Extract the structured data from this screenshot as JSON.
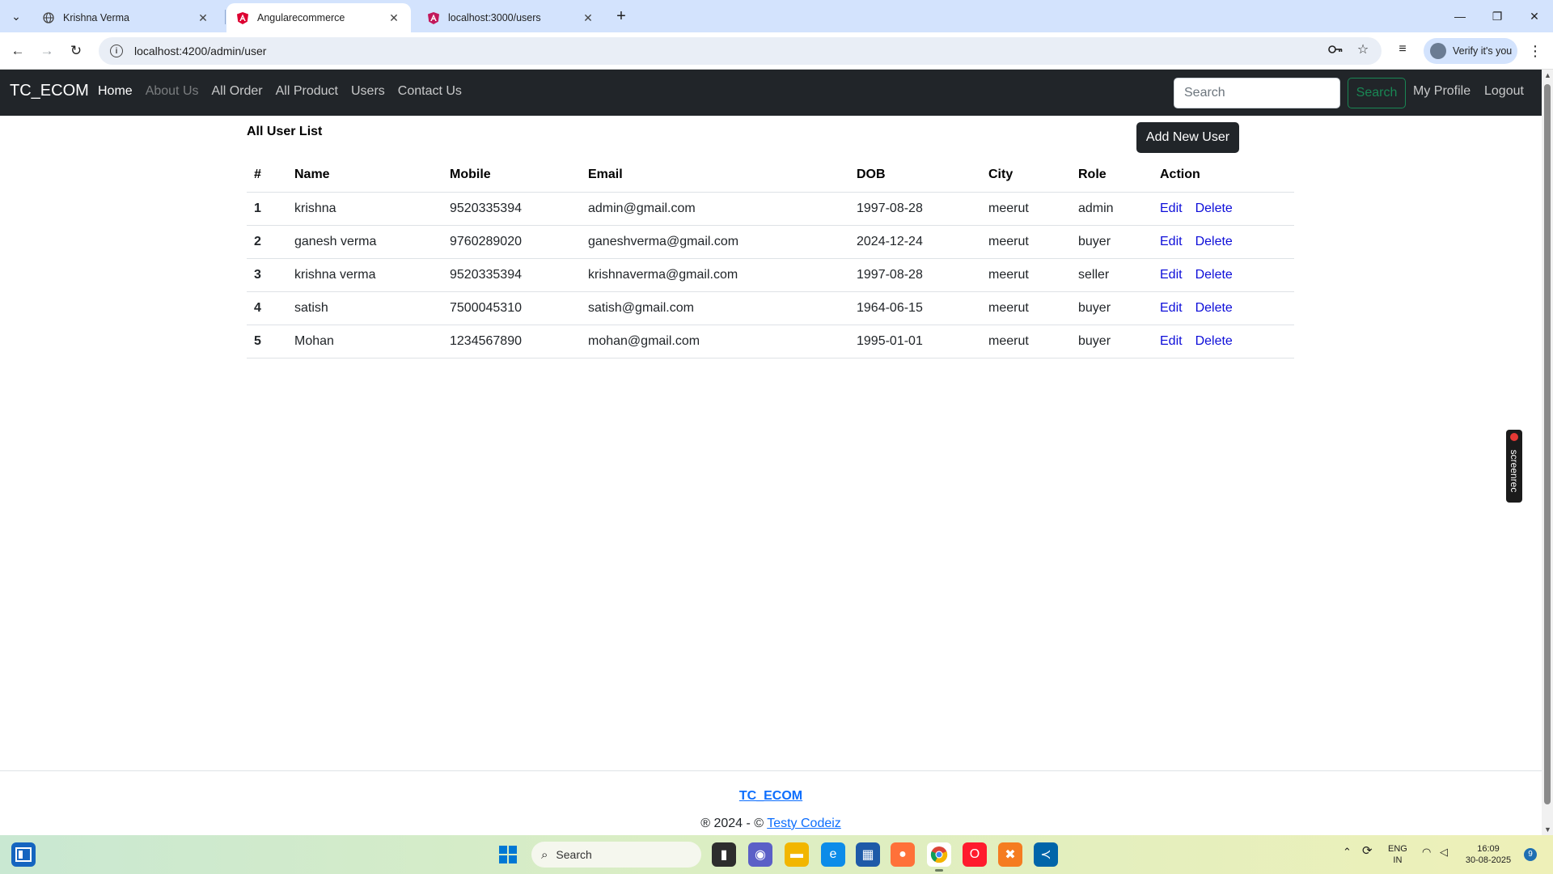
{
  "browser": {
    "tabs": [
      {
        "title": "Krishna Verma",
        "active": false
      },
      {
        "title": "Angularecommerce",
        "active": true
      },
      {
        "title": "localhost:3000/users",
        "active": false
      }
    ],
    "url": "localhost:4200/admin/user",
    "verify_label": "Verify it's you"
  },
  "navbar": {
    "brand": "TC_ECOM",
    "links": [
      "Home",
      "About Us",
      "All Order",
      "All Product",
      "Users",
      "Contact Us"
    ],
    "search_placeholder": "Search",
    "search_button": "Search",
    "profile": "My Profile",
    "logout": "Logout"
  },
  "content": {
    "title": "All User List",
    "add_button": "Add New User",
    "columns": [
      "#",
      "Name",
      "Mobile",
      "Email",
      "DOB",
      "City",
      "Role",
      "Action"
    ],
    "rows": [
      {
        "idx": "1",
        "name": "krishna",
        "mobile": "9520335394",
        "email": "admin@gmail.com",
        "dob": "1997-08-28",
        "city": "meerut",
        "role": "admin"
      },
      {
        "idx": "2",
        "name": "ganesh verma",
        "mobile": "9760289020",
        "email": "ganeshverma@gmail.com",
        "dob": "2024-12-24",
        "city": "meerut",
        "role": "buyer"
      },
      {
        "idx": "3",
        "name": "krishna verma",
        "mobile": "9520335394",
        "email": "krishnaverma@gmail.com",
        "dob": "1997-08-28",
        "city": "meerut",
        "role": "seller"
      },
      {
        "idx": "4",
        "name": "satish",
        "mobile": "7500045310",
        "email": "satish@gmail.com",
        "dob": "1964-06-15",
        "city": "meerut",
        "role": "buyer"
      },
      {
        "idx": "5",
        "name": "Mohan",
        "mobile": "1234567890",
        "email": "mohan@gmail.com",
        "dob": "1995-01-01",
        "city": "meerut",
        "role": "buyer"
      }
    ],
    "edit_label": "Edit",
    "delete_label": "Delete"
  },
  "footer": {
    "brand": "TC_ECOM",
    "copy_prefix": "® 2024 - ©",
    "copy_link": "Testy Codeiz"
  },
  "overlay": {
    "screenrec": "screenrec"
  },
  "taskbar": {
    "search_label": "Search",
    "lang_top": "ENG",
    "lang_bottom": "IN",
    "time": "16:09",
    "date": "30-08-2025",
    "notif_count": "9"
  },
  "colors": {
    "navbar_bg": "#212529",
    "link": "#0d0dd9",
    "search_btn": "#198754",
    "footer_link": "#0d6efd"
  }
}
